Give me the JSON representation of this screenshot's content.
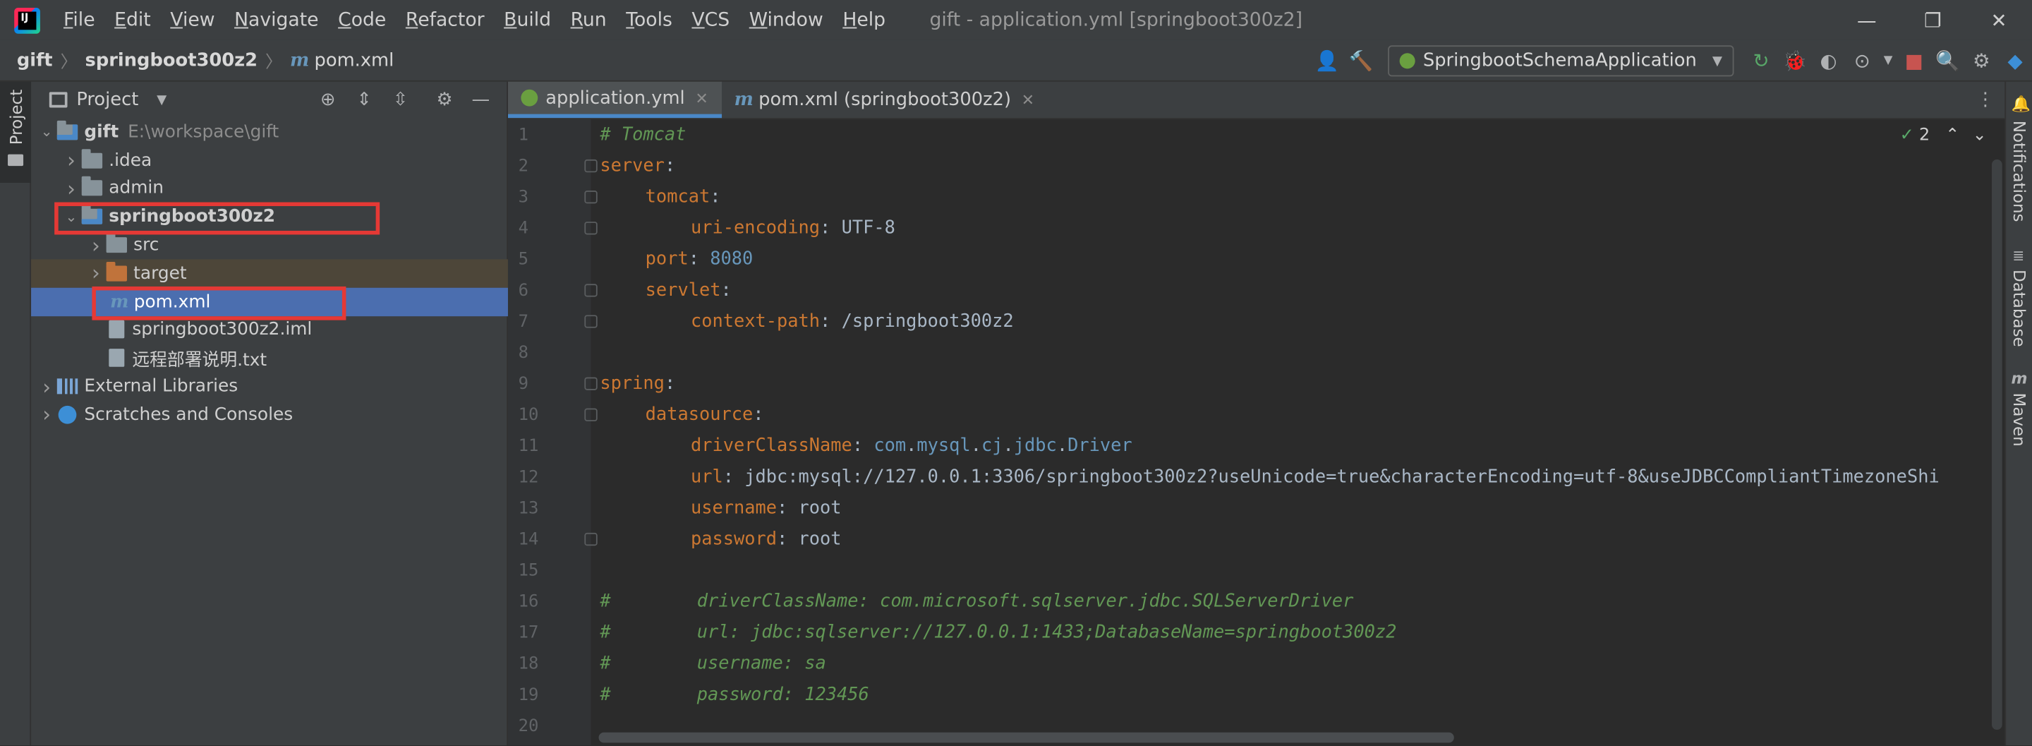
{
  "menubar": {
    "logo_text": "IJ",
    "items": [
      "File",
      "Edit",
      "View",
      "Navigate",
      "Code",
      "Refactor",
      "Build",
      "Run",
      "Tools",
      "VCS",
      "Window",
      "Help"
    ],
    "window_title": "gift - application.yml [springboot300z2]",
    "controls": {
      "minimize": "—",
      "restore": "❐",
      "close": "✕"
    }
  },
  "breadcrumb": {
    "root": "gift",
    "module": "springboot300z2",
    "file": "pom.xml",
    "file_icon": "m"
  },
  "toolbar": {
    "run_config": "SpringbootSchemaApplication"
  },
  "left_strip": {
    "project_tab": "Project"
  },
  "project": {
    "title": "Project",
    "tree": [
      {
        "label": "gift",
        "hint": "E:\\workspace\\gift",
        "depth": 0,
        "open": true,
        "kind": "module",
        "bold": true
      },
      {
        "label": ".idea",
        "depth": 1,
        "open": false,
        "kind": "folder"
      },
      {
        "label": "admin",
        "depth": 1,
        "open": false,
        "kind": "folder"
      },
      {
        "label": "springboot300z2",
        "depth": 1,
        "open": true,
        "kind": "module",
        "bold": true
      },
      {
        "label": "src",
        "depth": 2,
        "open": false,
        "kind": "folder"
      },
      {
        "label": "target",
        "depth": 2,
        "open": false,
        "kind": "folder-orange"
      },
      {
        "label": "pom.xml",
        "depth": 2,
        "kind": "maven",
        "selected": true
      },
      {
        "label": "springboot300z2.iml",
        "depth": 2,
        "kind": "file"
      },
      {
        "label": "远程部署说明.txt",
        "depth": 2,
        "kind": "file"
      },
      {
        "label": "External Libraries",
        "depth": 0,
        "open": false,
        "kind": "lib"
      },
      {
        "label": "Scratches and Consoles",
        "depth": 0,
        "open": false,
        "kind": "scratch"
      }
    ]
  },
  "editor": {
    "tabs": [
      {
        "label": "application.yml",
        "active": true,
        "icon": "yml-icon"
      },
      {
        "label": "pom.xml (springboot300z2)",
        "active": false,
        "icon": "maven-icon"
      }
    ],
    "inspection_count": "2",
    "lines": [
      {
        "n": "1",
        "indent": 0,
        "parts": [
          [
            "c",
            "# Tomcat"
          ]
        ]
      },
      {
        "n": "2",
        "indent": 0,
        "fold": true,
        "parts": [
          [
            "k",
            "server"
          ],
          [
            "v",
            ":"
          ]
        ]
      },
      {
        "n": "3",
        "indent": 1,
        "fold": true,
        "parts": [
          [
            "k",
            "tomcat"
          ],
          [
            "v",
            ":"
          ]
        ]
      },
      {
        "n": "4",
        "indent": 2,
        "fold": true,
        "parts": [
          [
            "k",
            "uri-encoding"
          ],
          [
            "v",
            ": UTF-8"
          ]
        ]
      },
      {
        "n": "5",
        "indent": 1,
        "parts": [
          [
            "k",
            "port"
          ],
          [
            "v",
            ": "
          ],
          [
            "n",
            "8080"
          ]
        ]
      },
      {
        "n": "6",
        "indent": 1,
        "fold": true,
        "parts": [
          [
            "k",
            "servlet"
          ],
          [
            "v",
            ":"
          ]
        ]
      },
      {
        "n": "7",
        "indent": 2,
        "fold": true,
        "parts": [
          [
            "k",
            "context-path"
          ],
          [
            "v",
            ": /springboot300z2"
          ]
        ]
      },
      {
        "n": "8",
        "indent": 0,
        "parts": []
      },
      {
        "n": "9",
        "indent": 0,
        "fold": true,
        "parts": [
          [
            "k",
            "spring"
          ],
          [
            "v",
            ":"
          ]
        ]
      },
      {
        "n": "10",
        "indent": 1,
        "fold": true,
        "parts": [
          [
            "k",
            "datasource"
          ],
          [
            "v",
            ":"
          ]
        ]
      },
      {
        "n": "11",
        "indent": 2,
        "parts": [
          [
            "k",
            "driverClassName"
          ],
          [
            "v",
            ": "
          ],
          [
            "n",
            "com"
          ],
          [
            "v",
            "."
          ],
          [
            "n",
            "mysql"
          ],
          [
            "v",
            "."
          ],
          [
            "n",
            "cj"
          ],
          [
            "v",
            "."
          ],
          [
            "n",
            "jdbc"
          ],
          [
            "v",
            "."
          ],
          [
            "n",
            "Driver"
          ]
        ]
      },
      {
        "n": "12",
        "indent": 2,
        "parts": [
          [
            "k",
            "url"
          ],
          [
            "v",
            ": jdbc:mysql://127.0.0.1:3306/springboot300z2?useUnicode=true&characterEncoding=utf-8&useJDBCCompliantTimezoneShi"
          ]
        ]
      },
      {
        "n": "13",
        "indent": 2,
        "parts": [
          [
            "k",
            "username"
          ],
          [
            "v",
            ": root"
          ]
        ]
      },
      {
        "n": "14",
        "indent": 2,
        "fold": true,
        "parts": [
          [
            "k",
            "password"
          ],
          [
            "v",
            ": root"
          ]
        ]
      },
      {
        "n": "15",
        "indent": 0,
        "parts": []
      },
      {
        "n": "16",
        "indent": 0,
        "parts": [
          [
            "c",
            "#        driverClassName: com.microsoft.sqlserver.jdbc.SQLServerDriver"
          ]
        ]
      },
      {
        "n": "17",
        "indent": 0,
        "parts": [
          [
            "c",
            "#        url: jdbc:sqlserver://127.0.0.1:1433;DatabaseName=springboot300z2"
          ]
        ]
      },
      {
        "n": "18",
        "indent": 0,
        "parts": [
          [
            "c",
            "#        username: sa"
          ]
        ]
      },
      {
        "n": "19",
        "indent": 0,
        "parts": [
          [
            "c",
            "#        password: 123456"
          ]
        ]
      },
      {
        "n": "20",
        "indent": 0,
        "parts": []
      }
    ]
  },
  "right_strip": {
    "items": [
      "Notifications",
      "Database",
      "Maven"
    ]
  }
}
